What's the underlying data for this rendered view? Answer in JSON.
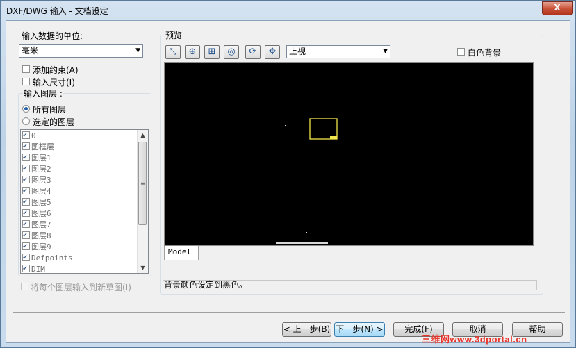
{
  "window": {
    "title": "DXF/DWG 输入 - 文档设定",
    "close_label": "X"
  },
  "left": {
    "units_label": "输入数据的单位:",
    "units_value": "毫米",
    "add_constraints_label": "添加约束(A)",
    "import_dimensions_label": "输入尺寸(I)",
    "layers_group_label": "输入图层 :",
    "all_layers_label": "所有图层",
    "selected_layers_label": "选定的图层",
    "layers": [
      {
        "name": "0",
        "checked": true
      },
      {
        "name": "图框层",
        "checked": true
      },
      {
        "name": "图层1",
        "checked": true
      },
      {
        "name": "图层2",
        "checked": true
      },
      {
        "name": "图层3",
        "checked": true
      },
      {
        "name": "图层4",
        "checked": true
      },
      {
        "name": "图层5",
        "checked": true
      },
      {
        "name": "图层6",
        "checked": true
      },
      {
        "name": "图层7",
        "checked": true
      },
      {
        "name": "图层8",
        "checked": true
      },
      {
        "name": "图层9",
        "checked": true
      },
      {
        "name": "Defpoints",
        "checked": true
      },
      {
        "name": "DIM",
        "checked": true
      }
    ],
    "each_layer_new_sketch_label": "将每个图层输入到新草图(I)"
  },
  "preview": {
    "group_label": "预览",
    "view_value": "上视",
    "white_bg_label": "白色背景",
    "model_tab": "Model",
    "status_text": "背景颜色设定到黑色。",
    "toolbar_icons": [
      "zoom-fit-icon",
      "zoom-in-icon",
      "zoom-window-icon",
      "zoom-area-icon",
      "rotate-icon",
      "pan-icon"
    ],
    "drawing_color": "#f2e84b"
  },
  "buttons": {
    "back": "< 上一步(B)",
    "next": "下一步(N) >",
    "finish": "完成(F)",
    "cancel": "取消",
    "help": "帮助"
  },
  "watermark": "三维网www.3dportal.cn"
}
